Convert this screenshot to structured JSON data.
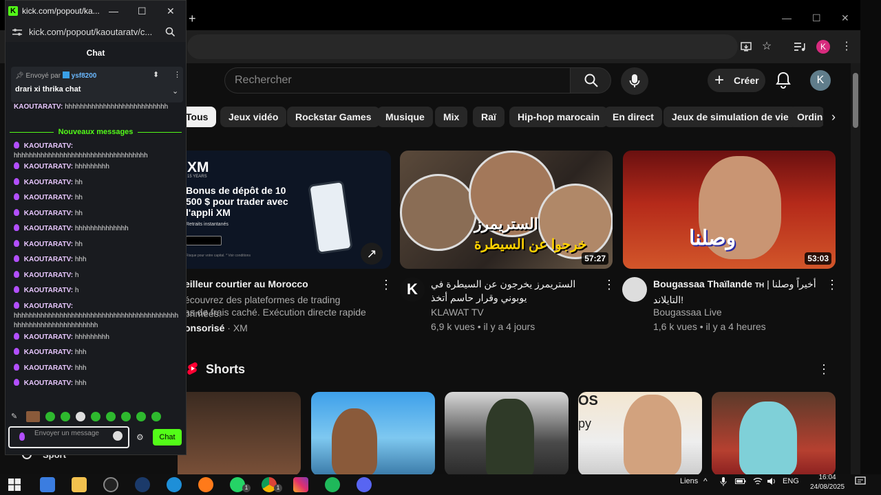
{
  "browser": {
    "new_tab": "+",
    "min": "—",
    "max": "☐",
    "close": "✕",
    "profile_initial": "K"
  },
  "youtube": {
    "search_placeholder": "Rechercher",
    "create_label": "Créer",
    "user_initial": "K",
    "chips": [
      "Tous",
      "Jeux vidéo",
      "Rockstar Games",
      "Musique",
      "Mix",
      "Raï",
      "Hip-hop marocain",
      "En direct",
      "Jeux de simulation de vie",
      "Ordina"
    ],
    "ad": {
      "brand": "XM",
      "brand_sub": "15 YEARS",
      "headline": "Bonus de dépôt de 10 500 $ pour trader avec l'appli XM",
      "note": "Retraits instantanés",
      "disclaimer": "Risque pour votre capital. * Voir conditions",
      "title": "eilleur courtier au Morocco",
      "desc1": "écouvrez des plateformes de trading primées.",
      "desc2": "as de frais caché. Exécution directe rapide",
      "sponsored": "onsorisé",
      "advertiser": "XM"
    },
    "videos": [
      {
        "thumb_text1": "الستريمرز",
        "thumb_text2": "خرجوا عن السيطرة",
        "duration": "57:27",
        "title": "الستريمرز يخرجون عن السيطرة في يوبوني وقرار حاسم أتخذ",
        "channel": "KLAWAT TV",
        "channel_initial": "K",
        "meta": "6,9 k vues • il y a 4 jours"
      },
      {
        "thumb_text": "وصلنا",
        "duration": "53:03",
        "title_en": "Bougassaa Thaïlande",
        "title_th": "TH",
        "title_ar": "أخيراً وصلنا | التايلاند!",
        "channel": "Bougassaa Live",
        "meta": "1,6 k vues • il y a 4 heures"
      }
    ],
    "shorts_title": "Shorts",
    "shorts_thumb_texts": [
      "OS",
      "py"
    ]
  },
  "kick": {
    "window_title": "kick.com/popout/ka...",
    "favicon": "K",
    "url": "kick.com/popout/kaoutaratv/c...",
    "header": "Chat",
    "pinned_sent_by": "Envoyé par",
    "pinned_user": "ysf8200",
    "pinned_message": "drari xi thrika chat",
    "top_user": "KAOUTARATV:",
    "top_msg": "hhhhhhhhhhhhhhhhhhhhhhhhhhh",
    "new_messages": "Nouveaux messages",
    "messages": [
      {
        "user": "KAOUTARATV:",
        "text": "hhhhhhhhhhhhhhhhhhhhhhhhhhhhhhhhhhh"
      },
      {
        "user": "KAOUTARATV:",
        "text": "hhhhhhhhh"
      },
      {
        "user": "KAOUTARATV:",
        "text": "hh"
      },
      {
        "user": "KAOUTARATV:",
        "text": "hh"
      },
      {
        "user": "KAOUTARATV:",
        "text": "hh"
      },
      {
        "user": "KAOUTARATV:",
        "text": "hhhhhhhhhhhhhh"
      },
      {
        "user": "KAOUTARATV:",
        "text": "hh"
      },
      {
        "user": "KAOUTARATV:",
        "text": "hhh"
      },
      {
        "user": "KAOUTARATV:",
        "text": "h"
      },
      {
        "user": "KAOUTARATV:",
        "text": "h"
      },
      {
        "user": "KAOUTARATV:",
        "text": "hhhhhhhhhhhhhhhhhhhhhhhhhhhhhhhhhhhhhhhhhhhhhhhhhhhhhhhhhhhhhhhhh"
      },
      {
        "user": "KAOUTARATV:",
        "text": "hhhhhhhhh"
      },
      {
        "user": "KAOUTARATV:",
        "text": "hhh"
      },
      {
        "user": "KAOUTARATV:",
        "text": "hhh"
      },
      {
        "user": "KAOUTARATV:",
        "text": "hhh"
      }
    ],
    "input_placeholder": "Envoyer un message",
    "send_label": "Chat",
    "accent": "#53fc18"
  },
  "sidebar_peek": "Sport",
  "taskbar": {
    "links_label": "Liens",
    "language": "ENG",
    "time": "16:04",
    "date": "24/08/2025",
    "whatsapp_badge": "1",
    "chrome_badge": "1"
  }
}
